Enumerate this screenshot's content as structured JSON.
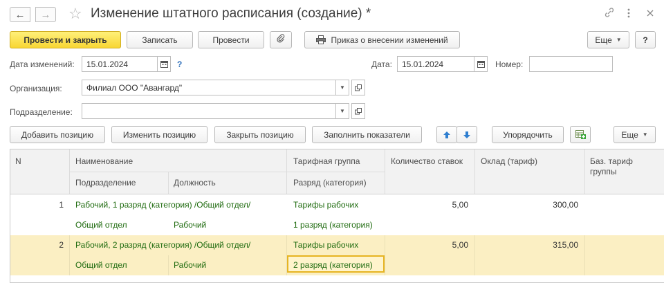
{
  "window": {
    "title": "Изменение штатного расписания (создание) *",
    "icons": [
      "back-arrow-icon",
      "forward-arrow-icon",
      "star-icon",
      "link-icon",
      "more-vertical-icon",
      "close-icon"
    ]
  },
  "toolbar": {
    "post_close": "Провести и закрыть",
    "save": "Записать",
    "post": "Провести",
    "order": "Приказ о внесении изменений",
    "more": "Еще",
    "help": "?"
  },
  "form": {
    "date_change_label": "Дата изменений:",
    "date_change_value": "15.01.2024",
    "help_mark": "?",
    "date_label": "Дата:",
    "date_value": "15.01.2024",
    "number_label": "Номер:",
    "number_value": "",
    "org_label": "Организация:",
    "org_value": "Филиал ООО \"Авангард\"",
    "dept_label": "Подразделение:",
    "dept_value": ""
  },
  "table_toolbar": {
    "add": "Добавить позицию",
    "change": "Изменить позицию",
    "close": "Закрыть позицию",
    "fill": "Заполнить показатели",
    "sort": "Упорядочить",
    "more": "Еще"
  },
  "table": {
    "headers": {
      "n": "N",
      "name": "Наименование",
      "dept": "Подразделение",
      "position": "Должность",
      "tariff_group": "Тарифная группа",
      "grade": "Разряд (категория)",
      "rate_count": "Количество ставок",
      "salary": "Оклад (тариф)",
      "base_tariff_1": "Баз. тариф",
      "base_tariff_2": "группы"
    },
    "rows": [
      {
        "n": "1",
        "name": "Рабочий, 1 разряд (категория) /Общий отдел/",
        "tariff_group": "Тарифы рабочих",
        "rate_count": "5,00",
        "salary": "300,00",
        "dept": "Общий отдел",
        "position": "Рабочий",
        "grade": "1 разряд (категория)"
      },
      {
        "n": "2",
        "name": "Рабочий, 2 разряд (категория) /Общий отдел/",
        "tariff_group": "Тарифы рабочих",
        "rate_count": "5,00",
        "salary": "315,00",
        "dept": "Общий отдел",
        "position": "Рабочий",
        "grade": "2 разряд (категория)"
      }
    ]
  },
  "colors": {
    "primary_button": "#f8d633",
    "selected_row": "#fbefc3",
    "green_text": "#1f6b0f",
    "link_blue": "#2e6fba"
  }
}
